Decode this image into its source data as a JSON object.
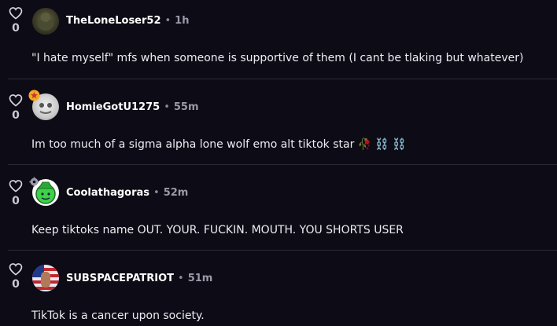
{
  "comments": [
    {
      "username": "TheLoneLoser52",
      "separator": "•",
      "time": "1h",
      "likes": "0",
      "text": "\"I hate myself\" mfs when someone is supportive of them (I cant be tlaking but whatever)",
      "avatar": "dark-green-avatar"
    },
    {
      "username": "HomieGotU1275",
      "separator": "•",
      "time": "55m",
      "likes": "0",
      "text": "Im too much of a sigma alpha lone wolf emo alt tiktok star 🥀 ⛓️ ⛓️",
      "avatar": "white-fuzzy-avatar",
      "badge": "star-badge"
    },
    {
      "username": "Coolathagoras",
      "separator": "•",
      "time": "52m",
      "likes": "0",
      "text": "Keep tiktoks name OUT. YOUR. FUCKIN. MOUTH. YOU SHORTS USER",
      "avatar": "green-smiley-cowboy-avatar",
      "badge": "gear-badge"
    },
    {
      "username": "SUBSPACEPATRIOT",
      "separator": "•",
      "time": "51m",
      "likes": "0",
      "text": "TikTok is a cancer upon society.",
      "avatar": "patriot-flag-avatar"
    }
  ],
  "colors": {
    "background": "#0d0c16",
    "divider": "#2b2a38",
    "badge_star": "#f5a623",
    "avatar_green": "#3fd14a"
  }
}
